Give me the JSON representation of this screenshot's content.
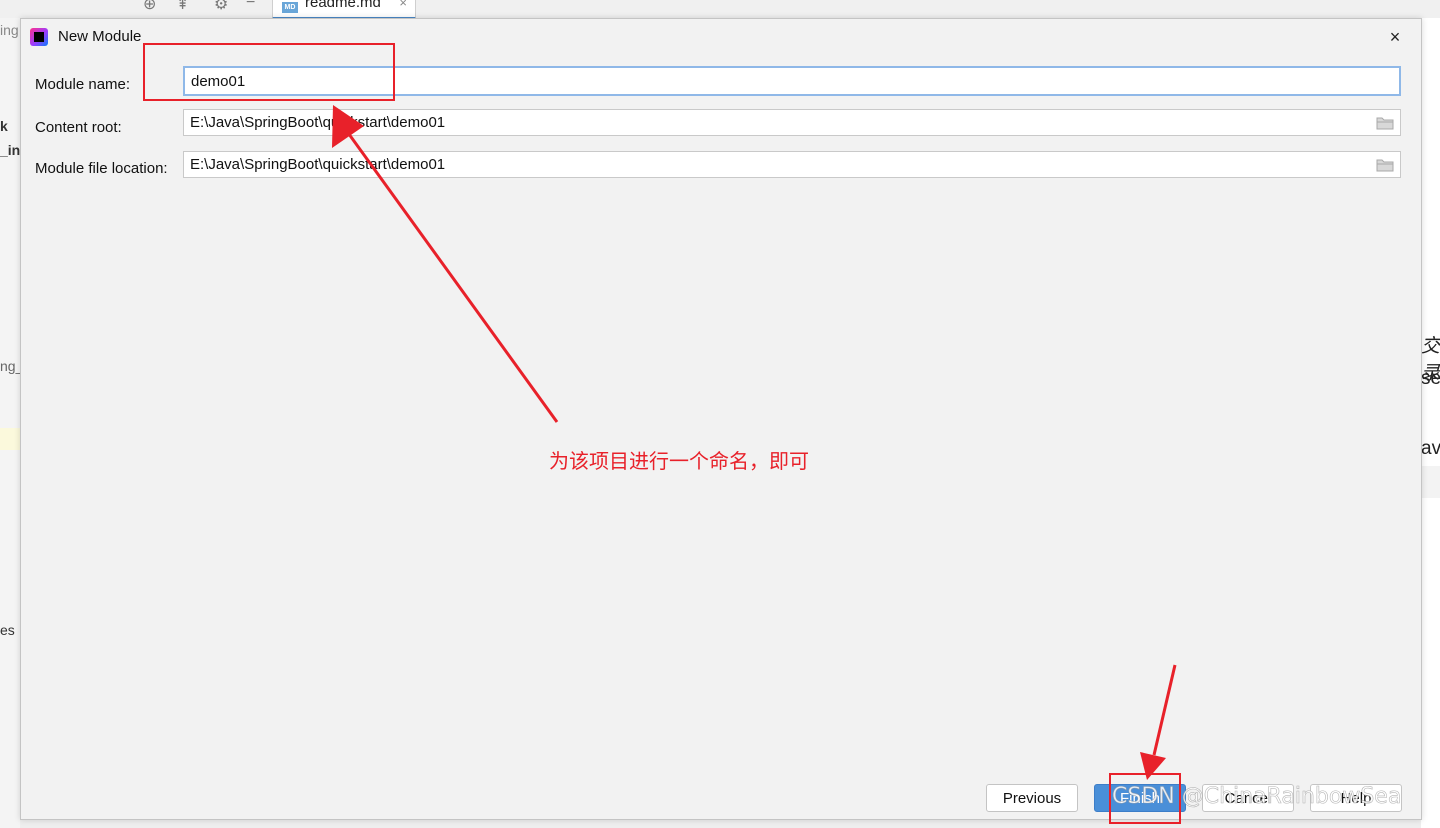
{
  "background": {
    "tab_label": "readme.md",
    "tab_badge": "MD",
    "tab_close": "×",
    "left_fragments": [
      "ing",
      "k",
      "_ini",
      "ng_",
      "es"
    ],
    "right_fragments": [
      "交录",
      "se",
      "av"
    ]
  },
  "dialog": {
    "title": "New Module",
    "close_label": "×",
    "fields": {
      "module_name": {
        "label": "Module name:",
        "value": "demo01"
      },
      "content_root": {
        "label": "Content root:",
        "value": "E:\\Java\\SpringBoot\\quickstart\\demo01"
      },
      "module_file_location": {
        "label": "Module file location:",
        "value": "E:\\Java\\SpringBoot\\quickstart\\demo01"
      }
    },
    "buttons": {
      "previous": "Previous",
      "finish": "Finish",
      "cancel": "Cancel",
      "help": "Help"
    }
  },
  "annotation": {
    "text": "为该项目进行一个命名，即可",
    "color": "#e8212a"
  },
  "watermark": "CSDN @ChinaRainbowSea"
}
